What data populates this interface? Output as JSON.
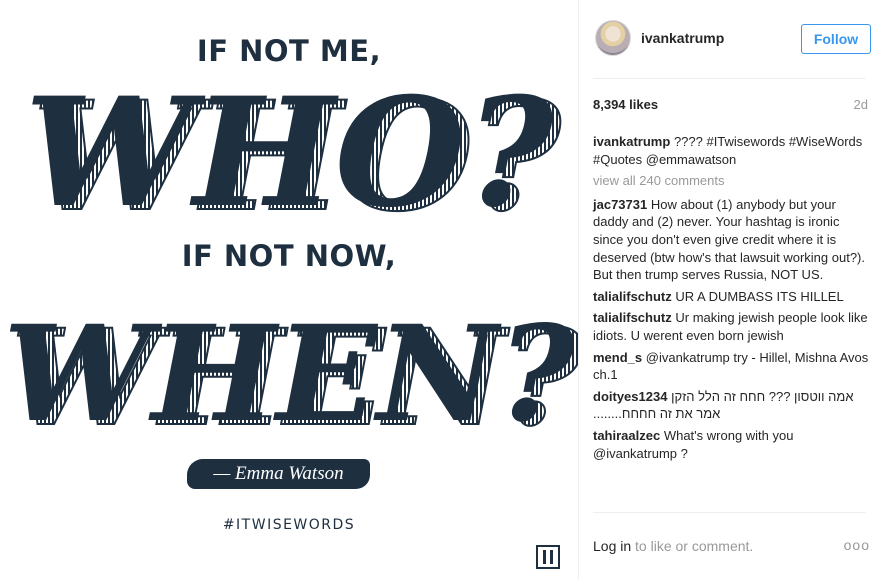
{
  "image": {
    "line_1": "IF NOT ME,",
    "word_1": "WHO?",
    "line_2": "IF NOT NOW,",
    "word_2": "WHEN?",
    "attribution": "— Emma Watson",
    "hashtag": "#ITWISEWORDS",
    "logo_icon": "ivanka-logo-icon",
    "ink_color": "#1e2f3f"
  },
  "header": {
    "username": "ivankatrump",
    "follow_label": "Follow",
    "accent_color": "#3897f0"
  },
  "stats": {
    "likes": "8,394 likes",
    "time": "2d"
  },
  "caption": {
    "user": "ivankatrump",
    "text": "???? #ITwisewords #WiseWords #Quotes @emmawatson"
  },
  "view_all": "view all 240 comments",
  "comments": [
    {
      "user": "jac73731",
      "text": "How about (1) anybody but your daddy and (2) never. Your hashtag is ironic since you don't even give credit where it is deserved (btw how's that lawsuit working out?). But then trump serves Russia, NOT US."
    },
    {
      "user": "talialifschutz",
      "text": "UR A DUMBASS ITS HILLEL"
    },
    {
      "user": "talialifschutz",
      "text": "Ur making jewish people look like idiots. U werent even born jewish"
    },
    {
      "user": "mend_s",
      "text": "@ivankatrump try - Hillel, Mishna Avos ch.1"
    },
    {
      "user": "doityes1234",
      "text": "אמה ווטסון ??? חחח זה הלל הזקן אמר את זה חחחח........"
    },
    {
      "user": "tahiraalzec",
      "text": "What's wrong with you @ivankatrump ?"
    }
  ],
  "footer": {
    "login_link": "Log in",
    "login_rest": " to like or comment.",
    "more_icon": "more-options-icon",
    "more_glyph": "ooo"
  }
}
